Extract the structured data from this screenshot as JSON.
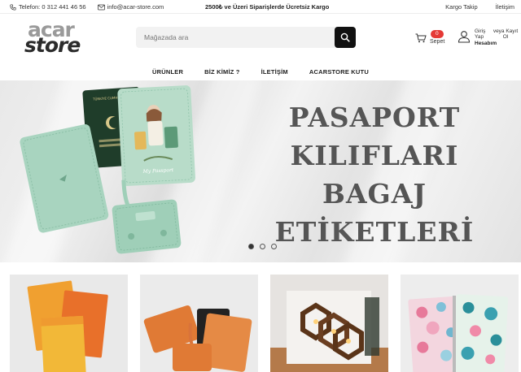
{
  "topbar": {
    "phone": "Telefon: 0 312 441 46 56",
    "email": "info@acar-store.com",
    "promo": "2500₺ ve Üzeri Siparişlerde Ücretsiz Kargo",
    "links": [
      "Kargo Takip",
      "İletişim"
    ]
  },
  "logo": {
    "line1": "acar",
    "line2": "store"
  },
  "search": {
    "placeholder": "Mağazada ara"
  },
  "cart": {
    "count": "0",
    "label": "Sepet"
  },
  "account": {
    "login": "Giriş Yap",
    "register": "veya Kayıt Ol",
    "label": "Hesabım"
  },
  "nav": [
    "ÜRÜNLER",
    "BİZ KİMİZ ?",
    "İLETİŞİM",
    "ACARSTORE KUTU"
  ],
  "hero": {
    "lines": [
      "PASAPORT",
      "KILIFLARI",
      "BAGAJ",
      "ETİKETLERİ"
    ],
    "passport_label": "My Passport",
    "slides": 3,
    "active_slide": 1
  },
  "colors": {
    "brand_dark": "#2b2b2b",
    "brand_gray": "#9a9a9a",
    "badge": "#e53935",
    "mint": "#9fcfb8"
  }
}
